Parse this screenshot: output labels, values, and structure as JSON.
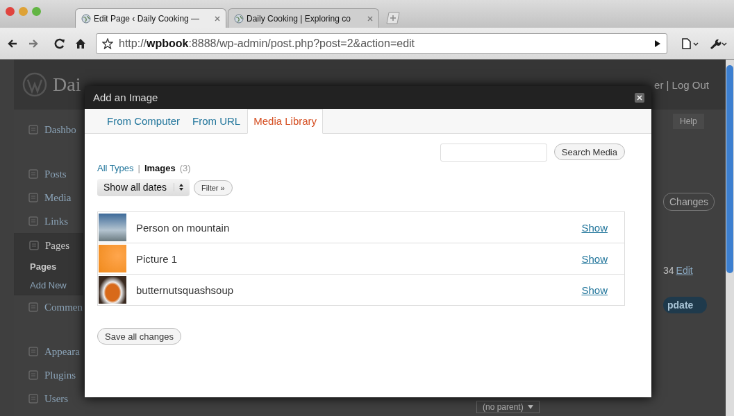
{
  "browser": {
    "tabs": [
      {
        "title": "Edit Page ‹ Daily Cooking —",
        "selected": true
      },
      {
        "title": "Daily Cooking | Exploring co",
        "selected": false
      }
    ],
    "address": "http://**wpbook**:8888/wp-admin/post.php?post=2&action=edit"
  },
  "admin": {
    "site_title": "Dai",
    "user_links": "er | Log Out",
    "help": "Help",
    "sidebar": [
      {
        "kind": "item",
        "label": "Dashbo",
        "selected": false
      },
      {
        "kind": "separator"
      },
      {
        "kind": "item",
        "label": "Posts",
        "selected": false
      },
      {
        "kind": "item",
        "label": "Media",
        "selected": false
      },
      {
        "kind": "item",
        "label": "Links",
        "selected": false
      },
      {
        "kind": "item",
        "label": "Pages",
        "selected": true,
        "children": [
          {
            "label": "Pages",
            "selected": true
          },
          {
            "label": "Add New",
            "selected": false
          }
        ]
      },
      {
        "kind": "item",
        "label": "Commen",
        "selected": false
      },
      {
        "kind": "separator"
      },
      {
        "kind": "item",
        "label": "Appeara",
        "selected": false
      },
      {
        "kind": "item",
        "label": "Plugins",
        "selected": false
      },
      {
        "kind": "item",
        "label": "Users",
        "selected": false
      }
    ],
    "preview_button": "Changes",
    "date_value": "34",
    "date_link": "Edit",
    "update_button": "pdate",
    "parent_select": "(no parent)"
  },
  "dialog": {
    "title": "Add an Image",
    "tabs": [
      {
        "label": "From Computer",
        "selected": false
      },
      {
        "label": "From URL",
        "selected": false
      },
      {
        "label": "Media Library",
        "selected": true
      }
    ],
    "filter_separator": "|",
    "type_filters": [
      {
        "label": "All Types",
        "selected": false
      },
      {
        "label": "Images",
        "count": "(3)",
        "selected": true
      }
    ],
    "search_button": "Search Media",
    "date_select": "Show all dates",
    "filter_button": "Filter »",
    "items": [
      {
        "title": "Person on mountain",
        "action": "Show"
      },
      {
        "title": "Picture 1",
        "action": "Show"
      },
      {
        "title": "butternutsquashsoup",
        "action": "Show"
      }
    ],
    "save_button": "Save all changes"
  }
}
